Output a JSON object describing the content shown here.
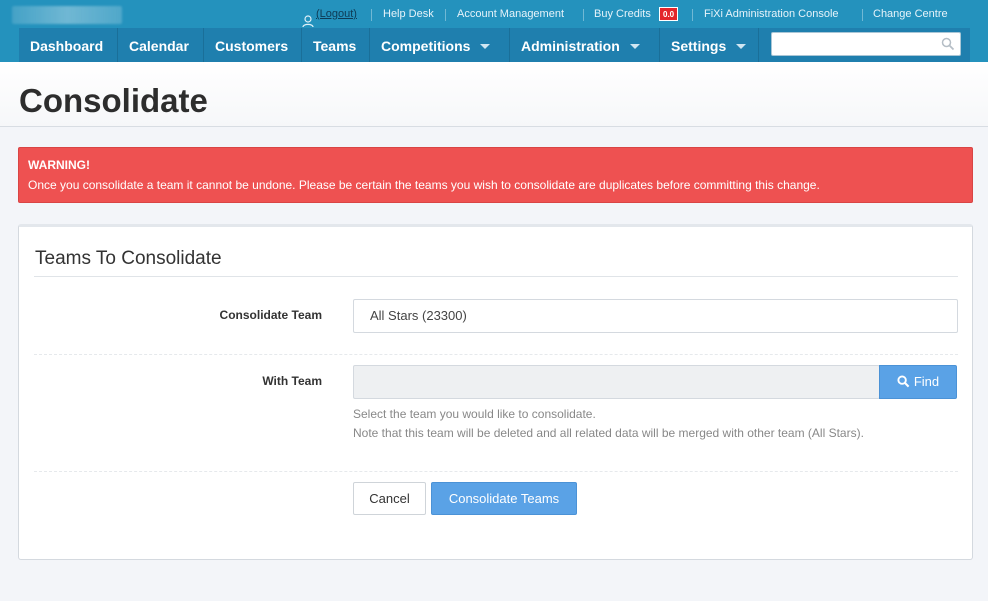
{
  "header": {
    "utility_links": {
      "logout": "(Logout)",
      "help_desk": "Help Desk",
      "account_management": "Account Management",
      "buy_credits": "Buy Credits",
      "credits_badge": "0.0",
      "admin_console": "FiXi Administration Console",
      "change_centre": "Change Centre"
    },
    "nav": {
      "dashboard": "Dashboard",
      "calendar": "Calendar",
      "customers": "Customers",
      "teams": "Teams",
      "competitions": "Competitions",
      "administration": "Administration",
      "settings": "Settings"
    },
    "search": {
      "placeholder": "",
      "value": ""
    }
  },
  "page": {
    "title": "Consolidate"
  },
  "warning": {
    "title": "WARNING!",
    "text": "Once you consolidate a team it cannot be undone. Please be certain the teams you wish to consolidate are duplicates before committing this change."
  },
  "panel": {
    "title": "Teams To Consolidate",
    "consolidate_team": {
      "label": "Consolidate Team",
      "value": "All Stars (23300)"
    },
    "with_team": {
      "label": "With Team",
      "value": "",
      "find_label": "Find",
      "help_line1": "Select the team you would like to consolidate.",
      "help_line2": "Note that this team will be deleted and all related data will be merged with other team (All Stars)."
    },
    "buttons": {
      "cancel": "Cancel",
      "submit": "Consolidate Teams"
    }
  },
  "colors": {
    "header_bg": "#2492bd",
    "nav_bg": "#1f7fae",
    "alert_bg": "#ee5151",
    "primary_button": "#5aa2e6"
  },
  "icons": {
    "user": "user-icon",
    "search": "search-icon",
    "find": "magnifier-icon",
    "dropdown": "caret-down-icon"
  }
}
